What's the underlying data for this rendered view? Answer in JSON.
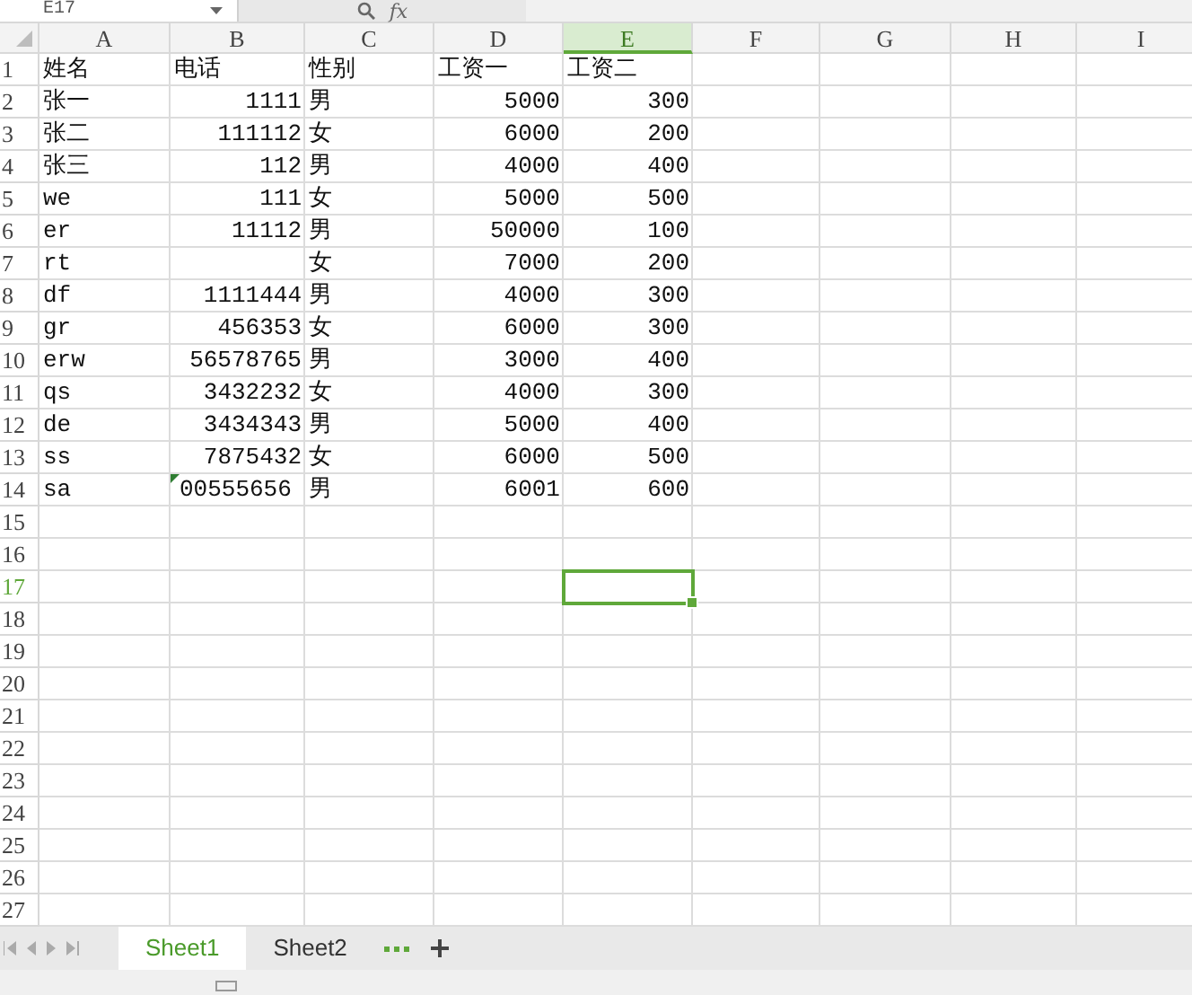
{
  "formula_bar": {
    "name_box": "E17",
    "function_label": "fx"
  },
  "grid": {
    "columns": [
      {
        "label": "A",
        "selected": false
      },
      {
        "label": "B",
        "selected": false
      },
      {
        "label": "C",
        "selected": false
      },
      {
        "label": "D",
        "selected": false
      },
      {
        "label": "E",
        "selected": true
      },
      {
        "label": "F",
        "selected": false
      },
      {
        "label": "G",
        "selected": false
      },
      {
        "label": "H",
        "selected": false
      },
      {
        "label": "I",
        "selected": false
      }
    ],
    "rows": [
      {
        "number": "1",
        "selected": false,
        "cells": [
          {
            "text": "姓名",
            "kind": "text"
          },
          {
            "text": "电话",
            "kind": "text"
          },
          {
            "text": "性别",
            "kind": "text"
          },
          {
            "text": "工资一",
            "kind": "text"
          },
          {
            "text": "工资二",
            "kind": "text"
          }
        ]
      },
      {
        "number": "2",
        "selected": false,
        "cells": [
          {
            "text": "张一",
            "kind": "text"
          },
          {
            "text": "1111",
            "kind": "number"
          },
          {
            "text": "男",
            "kind": "text"
          },
          {
            "text": "5000",
            "kind": "number"
          },
          {
            "text": "300",
            "kind": "number"
          }
        ]
      },
      {
        "number": "3",
        "selected": false,
        "cells": [
          {
            "text": "张二",
            "kind": "text"
          },
          {
            "text": "111112",
            "kind": "number"
          },
          {
            "text": "女",
            "kind": "text"
          },
          {
            "text": "6000",
            "kind": "number"
          },
          {
            "text": "200",
            "kind": "number"
          }
        ]
      },
      {
        "number": "4",
        "selected": false,
        "cells": [
          {
            "text": "张三",
            "kind": "text"
          },
          {
            "text": "112",
            "kind": "number"
          },
          {
            "text": "男",
            "kind": "text"
          },
          {
            "text": "4000",
            "kind": "number"
          },
          {
            "text": "400",
            "kind": "number"
          }
        ]
      },
      {
        "number": "5",
        "selected": false,
        "cells": [
          {
            "text": "we",
            "kind": "text"
          },
          {
            "text": "111",
            "kind": "number"
          },
          {
            "text": "女",
            "kind": "text"
          },
          {
            "text": "5000",
            "kind": "number"
          },
          {
            "text": "500",
            "kind": "number"
          }
        ]
      },
      {
        "number": "6",
        "selected": false,
        "cells": [
          {
            "text": "er",
            "kind": "text"
          },
          {
            "text": "11112",
            "kind": "number"
          },
          {
            "text": "男",
            "kind": "text"
          },
          {
            "text": "50000",
            "kind": "number"
          },
          {
            "text": "100",
            "kind": "number"
          }
        ]
      },
      {
        "number": "7",
        "selected": false,
        "cells": [
          {
            "text": "rt",
            "kind": "text"
          },
          {
            "kind": "empty"
          },
          {
            "text": "女",
            "kind": "text"
          },
          {
            "text": "7000",
            "kind": "number"
          },
          {
            "text": "200",
            "kind": "number"
          }
        ]
      },
      {
        "number": "8",
        "selected": false,
        "cells": [
          {
            "text": "df",
            "kind": "text"
          },
          {
            "text": "1111444",
            "kind": "number"
          },
          {
            "text": "男",
            "kind": "text"
          },
          {
            "text": "4000",
            "kind": "number"
          },
          {
            "text": "300",
            "kind": "number"
          }
        ]
      },
      {
        "number": "9",
        "selected": false,
        "cells": [
          {
            "text": "gr",
            "kind": "text"
          },
          {
            "text": "456353",
            "kind": "number"
          },
          {
            "text": "女",
            "kind": "text"
          },
          {
            "text": "6000",
            "kind": "number"
          },
          {
            "text": "300",
            "kind": "number"
          }
        ]
      },
      {
        "number": "10",
        "selected": false,
        "cells": [
          {
            "text": "erw",
            "kind": "text"
          },
          {
            "text": "56578765",
            "kind": "number"
          },
          {
            "text": "男",
            "kind": "text"
          },
          {
            "text": "3000",
            "kind": "number"
          },
          {
            "text": "400",
            "kind": "number"
          }
        ]
      },
      {
        "number": "11",
        "selected": false,
        "cells": [
          {
            "text": "qs",
            "kind": "text"
          },
          {
            "text": "3432232",
            "kind": "number"
          },
          {
            "text": "女",
            "kind": "text"
          },
          {
            "text": "4000",
            "kind": "number"
          },
          {
            "text": "300",
            "kind": "number"
          }
        ]
      },
      {
        "number": "12",
        "selected": false,
        "cells": [
          {
            "text": "de",
            "kind": "text"
          },
          {
            "text": "3434343",
            "kind": "number"
          },
          {
            "text": "男",
            "kind": "text"
          },
          {
            "text": "5000",
            "kind": "number"
          },
          {
            "text": "400",
            "kind": "number"
          }
        ]
      },
      {
        "number": "13",
        "selected": false,
        "cells": [
          {
            "text": "ss",
            "kind": "text"
          },
          {
            "text": "7875432",
            "kind": "number"
          },
          {
            "text": "女",
            "kind": "text"
          },
          {
            "text": "6000",
            "kind": "number"
          },
          {
            "text": "500",
            "kind": "number"
          }
        ]
      },
      {
        "number": "14",
        "selected": false,
        "cells": [
          {
            "text": "sa",
            "kind": "text"
          },
          {
            "text": "00555656",
            "kind": "flagged"
          },
          {
            "text": "男",
            "kind": "text"
          },
          {
            "text": "6001",
            "kind": "number"
          },
          {
            "text": "600",
            "kind": "number"
          }
        ]
      },
      {
        "number": "15",
        "selected": false
      },
      {
        "number": "16",
        "selected": false
      },
      {
        "number": "17",
        "selected": true
      },
      {
        "number": "18",
        "selected": false
      },
      {
        "number": "19",
        "selected": false
      },
      {
        "number": "20",
        "selected": false
      },
      {
        "number": "21",
        "selected": false
      },
      {
        "number": "22",
        "selected": false
      },
      {
        "number": "23",
        "selected": false
      },
      {
        "number": "24",
        "selected": false
      },
      {
        "number": "25",
        "selected": false
      },
      {
        "number": "26",
        "selected": false
      },
      {
        "number": "27",
        "selected": false
      }
    ]
  },
  "sheet_tabs": [
    {
      "label": "Sheet1",
      "selected": true
    },
    {
      "label": "Sheet2",
      "selected": false
    }
  ]
}
